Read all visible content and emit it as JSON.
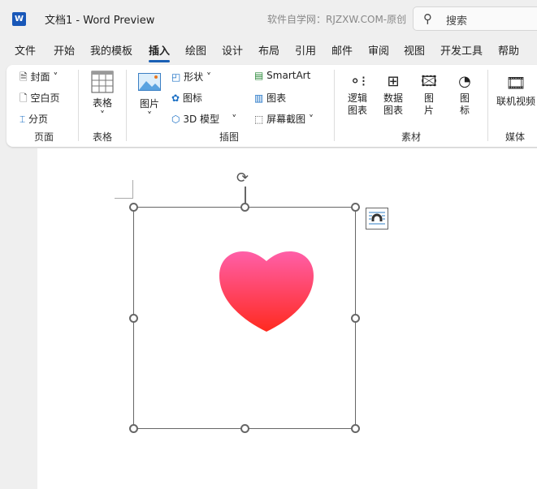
{
  "titlebar": {
    "app_icon": "word-logo-icon",
    "doc_title": "文档1  -  Word Preview",
    "watermark": "软件自学网：RJZXW.COM-原创",
    "search_placeholder": "搜索",
    "search_icon": "search-icon"
  },
  "tabs": [
    "文件",
    "开始",
    "我的模板",
    "插入",
    "绘图",
    "设计",
    "布局",
    "引用",
    "邮件",
    "审阅",
    "视图",
    "开发工具",
    "帮助"
  ],
  "active_tab": "插入",
  "ribbon": {
    "pages": {
      "cover": "封面",
      "blank": "空白页",
      "break": "分页",
      "group": "页面"
    },
    "table": {
      "label": "表格",
      "group": "表格"
    },
    "illustrations": {
      "picture": "图片",
      "shapes": "形状",
      "icons": "图标",
      "model3d": "3D 模型",
      "smartart": "SmartArt",
      "chart": "图表",
      "screenshot": "屏幕截图",
      "group": "插图"
    },
    "assets": {
      "logic_chart": [
        "逻辑",
        "图表"
      ],
      "data_chart": [
        "数据",
        "图表"
      ],
      "picture": [
        "图",
        "片"
      ],
      "icon": [
        "图",
        "标"
      ],
      "group": "素材"
    },
    "media": {
      "online_video": "联机视频",
      "group": "媒体"
    }
  },
  "canvas": {
    "selected_object": "heart-icon",
    "heart_colors": [
      "#ff5fa8",
      "#ff2a1f"
    ]
  }
}
